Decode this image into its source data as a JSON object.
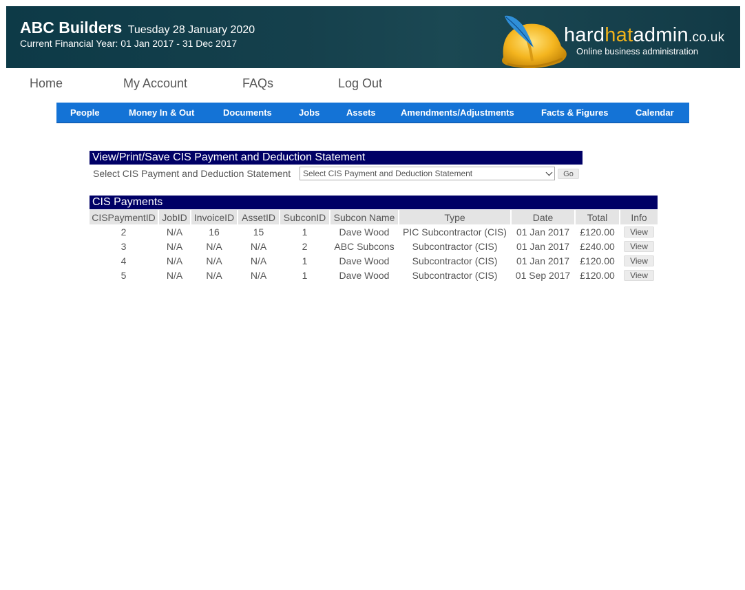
{
  "header": {
    "company": "ABC Builders",
    "date": "Tuesday 28 January 2020",
    "financial_year": "Current Financial Year: 01 Jan 2017 - 31 Dec 2017",
    "logo": {
      "hard": "hard",
      "hat": "hat",
      "admin": "admin",
      "tld": ".co.uk",
      "tagline": "Online business administration",
      "icon": "hard-hat-with-feather-icon"
    }
  },
  "top_nav": [
    "Home",
    "My Account",
    "FAQs",
    "Log Out"
  ],
  "main_nav": [
    "People",
    "Money In & Out",
    "Documents",
    "Jobs",
    "Assets",
    "Amendments/Adjustments",
    "Facts & Figures",
    "Calendar"
  ],
  "statement": {
    "title": "View/Print/Save CIS Payment and Deduction Statement",
    "label": "Select CIS Payment and Deduction Statement",
    "selected": "Select CIS Payment and Deduction Statement",
    "go_label": "Go"
  },
  "payments": {
    "title": "CIS Payments",
    "columns": [
      "CISPaymentID",
      "JobID",
      "InvoiceID",
      "AssetID",
      "SubconID",
      "Subcon Name",
      "Type",
      "Date",
      "Total",
      "Info"
    ],
    "rows": [
      [
        "2",
        "N/A",
        "16",
        "15",
        "1",
        "Dave Wood",
        "PIC Subcontractor (CIS)",
        "01 Jan 2017",
        "£120.00",
        "View"
      ],
      [
        "3",
        "N/A",
        "N/A",
        "N/A",
        "2",
        "ABC Subcons",
        "Subcontractor (CIS)",
        "01 Jan 2017",
        "£240.00",
        "View"
      ],
      [
        "4",
        "N/A",
        "N/A",
        "N/A",
        "1",
        "Dave Wood",
        "Subcontractor (CIS)",
        "01 Jan 2017",
        "£120.00",
        "View"
      ],
      [
        "5",
        "N/A",
        "N/A",
        "N/A",
        "1",
        "Dave Wood",
        "Subcontractor (CIS)",
        "01 Sep 2017",
        "£120.00",
        "View"
      ]
    ]
  },
  "colors": {
    "header_bg": "#15404c",
    "nav_blue": "#1473d6",
    "panel_title_bg": "#000066",
    "logo_accent": "#f0b21b"
  }
}
